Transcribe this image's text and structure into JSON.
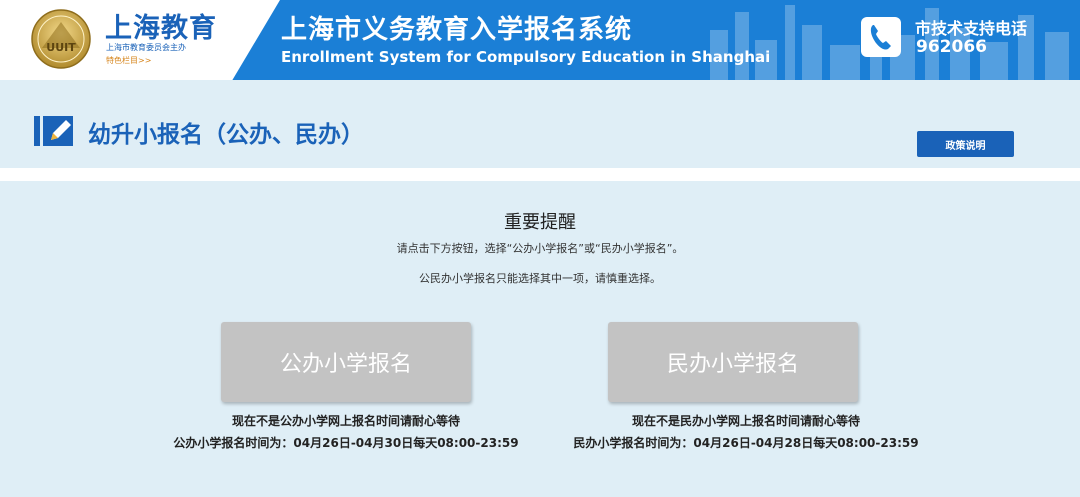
{
  "header": {
    "logo_title": "上海教育",
    "logo_subtitle": "上海市教育委员会主办",
    "logo_link": "特色栏目>>",
    "logo_emblem_text": "UUIT",
    "system_title": "上海市义务教育入学报名系统",
    "system_subtitle": "Enrollment System for Compulsory Education in Shanghai",
    "support_label": "市技术支持电话",
    "support_number": "962066",
    "background_color": "#1b7fd6",
    "logo_color": "#1a62b8"
  },
  "page": {
    "title": "幼升小报名（公办、民办）",
    "policy_button_label": "政策说明",
    "title_icon": "edit-icon"
  },
  "notice": {
    "title": "重要提醒",
    "line1": "请点击下方按钮，选择“公办小学报名”或“民办小学报名”。",
    "line2": "公民办小学报名只能选择其中一项，请慎重选择。"
  },
  "public_school": {
    "button_label": "公办小学报名",
    "status_text": "现在不是公办小学网上报名时间请耐心等待",
    "schedule_text": "公办小学报名时间为：04月26日-04月30日每天08:00-23:59"
  },
  "private_school": {
    "button_label": "民办小学报名",
    "status_text": "现在不是民办小学网上报名时间请耐心等待",
    "schedule_text": "民办小学报名时间为：04月26日-04月28日每天08:00-23:59"
  },
  "colors": {
    "accent": "#1a62b8",
    "panel_background": "#dfeef6",
    "disabled_button": "#c3c3c3"
  }
}
